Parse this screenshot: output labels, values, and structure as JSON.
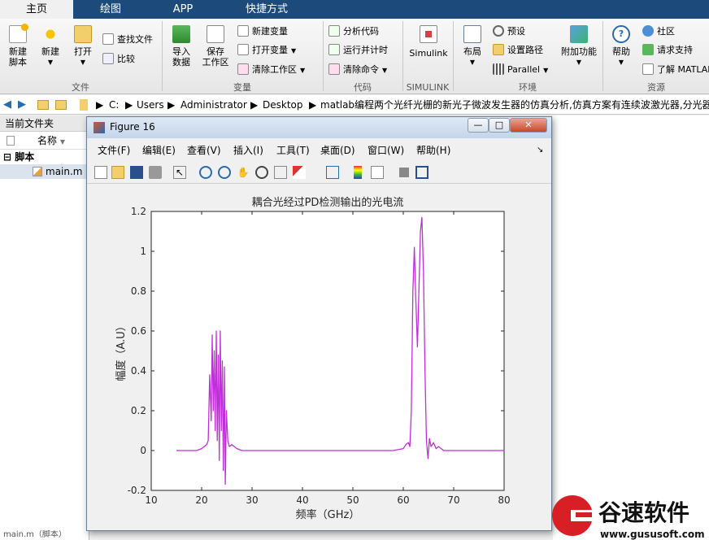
{
  "tabs": {
    "home": "主页",
    "plot": "绘图",
    "app": "APP",
    "shortcut": "快捷方式"
  },
  "ribbon": {
    "new_script": [
      "新建",
      "脚本"
    ],
    "new": "新建",
    "open": "打开",
    "find_files": "查找文件",
    "compare": "比较",
    "file_group": "文件",
    "import_data": [
      "导入",
      "数据"
    ],
    "save_ws": [
      "保存",
      "工作区"
    ],
    "new_var": "新建变量",
    "open_var": "打开变量",
    "clear_ws": "清除工作区",
    "var_group": "变量",
    "analyze_code": "分析代码",
    "run_time": "运行并计时",
    "clear_cmd": "清除命令",
    "code_group": "代码",
    "simulink": "Simulink",
    "simulink_group": "SIMULINK",
    "layout": "布局",
    "prefs": "预设",
    "set_path": "设置路径",
    "parallel": "Parallel",
    "addons": "附加功能",
    "env_group": "环境",
    "help": "帮助",
    "community": "社区",
    "support": "请求支持",
    "learn": "了解 MATLAB",
    "res_group": "资源"
  },
  "address": {
    "drive": "C:",
    "users": "Users",
    "admin": "Administrator",
    "desktop": "Desktop",
    "folder": "matlab编程两个光纤光栅的新光子微波发生器的仿真分析,仿真方案有连续波激光器,分光器"
  },
  "left_pane": {
    "title": "当前文件夹",
    "col_name": "名称",
    "group": "脚本",
    "file": "main.m",
    "bottom": "main.m（脚本）"
  },
  "figure": {
    "title": "Figure 16",
    "menu": [
      "文件(F)",
      "编辑(E)",
      "查看(V)",
      "插入(I)",
      "工具(T)",
      "桌面(D)",
      "窗口(W)",
      "帮助(H)"
    ]
  },
  "chart_data": {
    "type": "line",
    "title": "耦合光经过PD检测输出的光电流",
    "xlabel": "频率（GHz）",
    "ylabel": "幅度（A.U）",
    "xlim": [
      10,
      80
    ],
    "ylim": [
      -0.2,
      1.2
    ],
    "xticks": [
      10,
      20,
      30,
      40,
      50,
      60,
      70,
      80
    ],
    "yticks": [
      -0.2,
      0,
      0.2,
      0.4,
      0.6,
      0.8,
      1,
      1.2
    ],
    "color": "#bf2fd6",
    "x": [
      15,
      19,
      20,
      20.5,
      21,
      21.3,
      21.6,
      21.9,
      22.1,
      22.3,
      22.5,
      22.7,
      22.9,
      23.1,
      23.3,
      23.5,
      23.7,
      23.9,
      24.1,
      24.3,
      24.5,
      24.7,
      24.9,
      25.2,
      25.5,
      26,
      27,
      28,
      30,
      40,
      50,
      58,
      60,
      60.5,
      61,
      61.3,
      61.6,
      61.9,
      62.2,
      62.5,
      62.8,
      63.1,
      63.4,
      63.7,
      64,
      64.3,
      64.6,
      64.9,
      65.2,
      65.5,
      66,
      66.5,
      67,
      68,
      70,
      80
    ],
    "y": [
      0,
      0,
      0.01,
      0.02,
      0.03,
      0.05,
      0.38,
      0.15,
      0.58,
      0.2,
      0.5,
      0.1,
      0.6,
      0.05,
      0.48,
      -0.05,
      0.6,
      0.1,
      0.45,
      -0.1,
      0.42,
      -0.17,
      0.2,
      0.05,
      0.02,
      0.03,
      0.01,
      0,
      0,
      0,
      0,
      0,
      0.01,
      0.03,
      0.04,
      0.02,
      0.2,
      0.8,
      1.02,
      0.75,
      0.52,
      0.8,
      1.1,
      1.17,
      0.9,
      0.4,
      0.05,
      -0.04,
      0.06,
      0.02,
      0.04,
      0.01,
      0.02,
      0,
      0,
      0
    ]
  },
  "watermark": {
    "brand": "谷速软件",
    "url": "www.gususoft.com"
  }
}
